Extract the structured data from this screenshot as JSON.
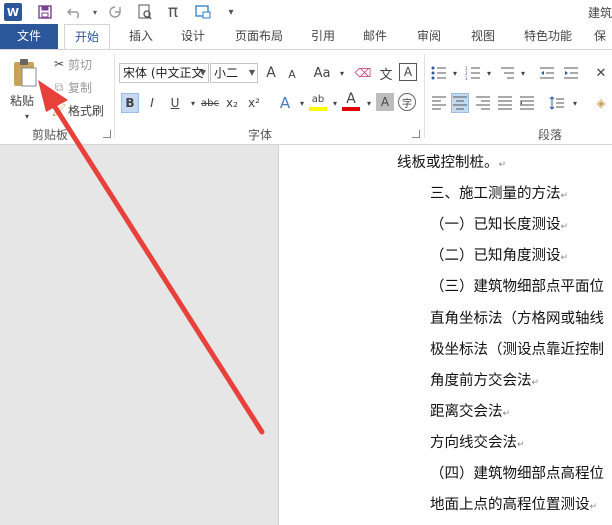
{
  "window": {
    "title": "建筑"
  },
  "qat": {
    "undo_icon": "undo-icon",
    "redo_icon": "redo-icon",
    "save_icon": "save-icon",
    "pi_symbol": "π"
  },
  "tabs": [
    {
      "label": "文件"
    },
    {
      "label": "开始"
    },
    {
      "label": "插入"
    },
    {
      "label": "设计"
    },
    {
      "label": "页面布局"
    },
    {
      "label": "引用"
    },
    {
      "label": "邮件"
    },
    {
      "label": "审阅"
    },
    {
      "label": "视图"
    },
    {
      "label": "特色功能"
    },
    {
      "label": "保"
    }
  ],
  "clipboard": {
    "paste_label": "粘贴",
    "cut_label": "剪切",
    "copy_label": "复制",
    "format_painter_label": "格式刷",
    "group_label": "剪贴板"
  },
  "font": {
    "font_name": "宋体 (中文正文",
    "font_size": "小二",
    "grow_label": "A",
    "shrink_label": "A",
    "case_label": "Aa",
    "group_label": "字体",
    "bold": "B",
    "italic": "I",
    "underline": "U",
    "strike": "abc",
    "subscript": "x₂",
    "superscript": "x²",
    "text_effect": "A",
    "highlight": "ab",
    "font_color": "A",
    "char_shading": "A",
    "enclose": "字"
  },
  "paragraph": {
    "group_label": "段落"
  },
  "document": {
    "lines": [
      "线板或控制桩。",
      "三、施工测量的方法",
      "（一）已知长度测设",
      "（二）已知角度测设",
      "（三）建筑物细部点平面位",
      "直角坐标法（方格网或轴线",
      "极坐标法（测设点靠近控制",
      "角度前方交会法",
      "距离交会法",
      "方向线交会法",
      "（四）建筑物细部点高程位",
      "地面上点的高程位置测设"
    ],
    "paragraph_mark": "↵"
  },
  "colors": {
    "file_tab": "#2b579a",
    "arrow": "#e8413c",
    "highlight_yellow": "#ffff00",
    "font_red": "#e00000"
  }
}
